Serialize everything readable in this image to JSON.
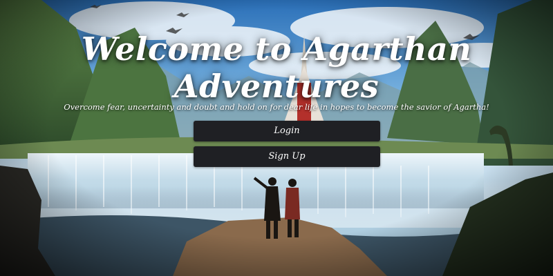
{
  "hero": {
    "title": "Welcome to Agarthan Adventures",
    "tagline": "Overcome fear, uncertainty and doubt and hold on for dear life in hopes to become the savior of Agartha!"
  },
  "actions": {
    "login_label": "Login",
    "signup_label": "Sign Up"
  },
  "colors": {
    "button_background": "#1f2024",
    "text": "#ffffff"
  }
}
